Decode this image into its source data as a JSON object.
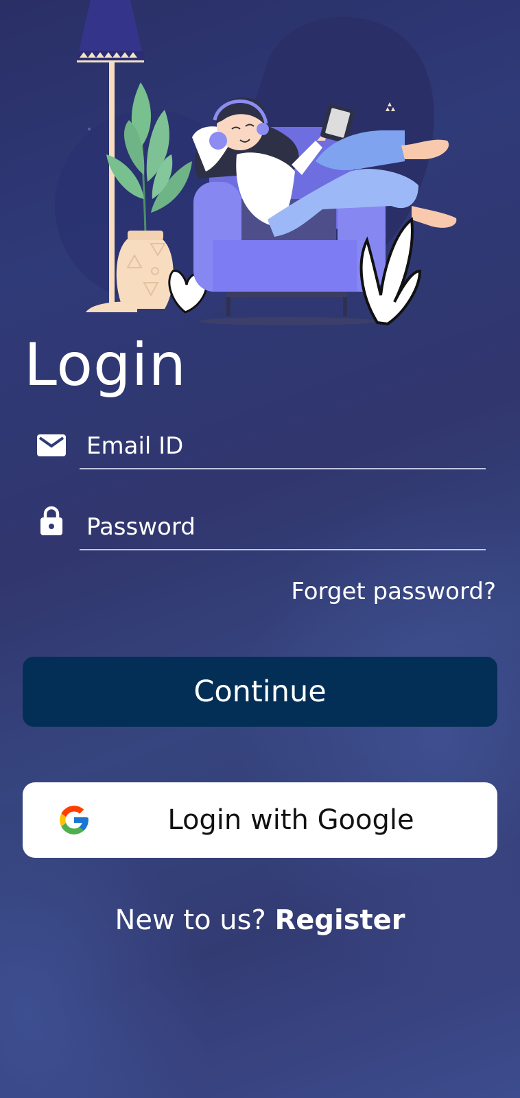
{
  "login": {
    "title": "Login",
    "email": {
      "placeholder": "Email ID",
      "icon": "envelope-icon"
    },
    "password": {
      "placeholder": "Password",
      "icon": "lock-icon"
    },
    "forgot_label": "Forget password?",
    "continue_label": "Continue",
    "google": {
      "label": "Login with Google",
      "icon": "google-g-icon"
    },
    "register": {
      "prompt": "New to us?",
      "link": "Register"
    }
  },
  "colors": {
    "continue_button": "#032f57",
    "google_button": "#ffffff",
    "chair": "#7d7cf2",
    "accent_blue": "#8fb3f8"
  }
}
